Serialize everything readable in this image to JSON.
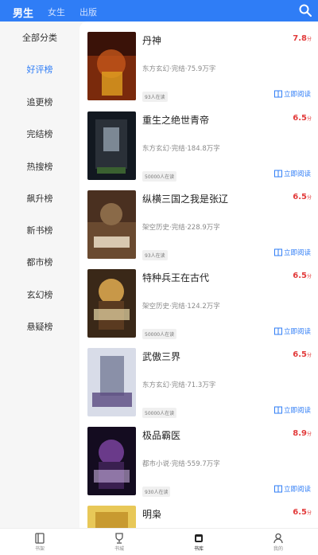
{
  "header": {
    "tabs": [
      {
        "label": "男生",
        "active": true
      },
      {
        "label": "女生",
        "active": false
      },
      {
        "label": "出版",
        "active": false
      }
    ],
    "search_icon": "search-icon"
  },
  "sidebar": {
    "items": [
      {
        "label": "全部分类",
        "active": false
      },
      {
        "label": "好评榜",
        "active": true
      },
      {
        "label": "追更榜",
        "active": false
      },
      {
        "label": "完结榜",
        "active": false
      },
      {
        "label": "热搜榜",
        "active": false
      },
      {
        "label": "飙升榜",
        "active": false
      },
      {
        "label": "新书榜",
        "active": false
      },
      {
        "label": "都市榜",
        "active": false
      },
      {
        "label": "玄幻榜",
        "active": false
      },
      {
        "label": "悬疑榜",
        "active": false
      }
    ]
  },
  "books": [
    {
      "title": "丹神",
      "score": "7.8",
      "score_unit": "分",
      "meta": "东方玄幻·完结·75.9万字",
      "badge": "93人在读",
      "read_label": "立即阅读"
    },
    {
      "title": "重生之绝世青帝",
      "score": "6.5",
      "score_unit": "分",
      "meta": "东方玄幻·完结·184.8万字",
      "badge": "50000人在读",
      "read_label": "立即阅读"
    },
    {
      "title": "纵横三国之我是张辽",
      "score": "6.5",
      "score_unit": "分",
      "meta": "架空历史·完结·228.9万字",
      "badge": "93人在读",
      "read_label": "立即阅读"
    },
    {
      "title": "特种兵王在古代",
      "score": "6.5",
      "score_unit": "分",
      "meta": "架空历史·完结·124.2万字",
      "badge": "50000人在读",
      "read_label": "立即阅读"
    },
    {
      "title": "武傲三界",
      "score": "6.5",
      "score_unit": "分",
      "meta": "东方玄幻·完结·71.3万字",
      "badge": "50000人在读",
      "read_label": "立即阅读"
    },
    {
      "title": "极品霸医",
      "score": "8.9",
      "score_unit": "分",
      "meta": "都市小说·完结·559.7万字",
      "badge": "930人在读",
      "read_label": "立即阅读"
    },
    {
      "title": "明枭",
      "score": "6.5",
      "score_unit": "分",
      "meta": "",
      "badge": "",
      "read_label": ""
    }
  ],
  "bottom_nav": [
    {
      "label": "书架",
      "icon": "book-icon",
      "active": false
    },
    {
      "label": "书城",
      "icon": "trophy-icon",
      "active": false
    },
    {
      "label": "书库",
      "icon": "library-icon",
      "active": true
    },
    {
      "label": "我的",
      "icon": "user-icon",
      "active": false
    }
  ],
  "colors": {
    "accent": "#2f7df6",
    "score": "#e23b3b",
    "sidebar_bg": "#f6f6f6"
  }
}
